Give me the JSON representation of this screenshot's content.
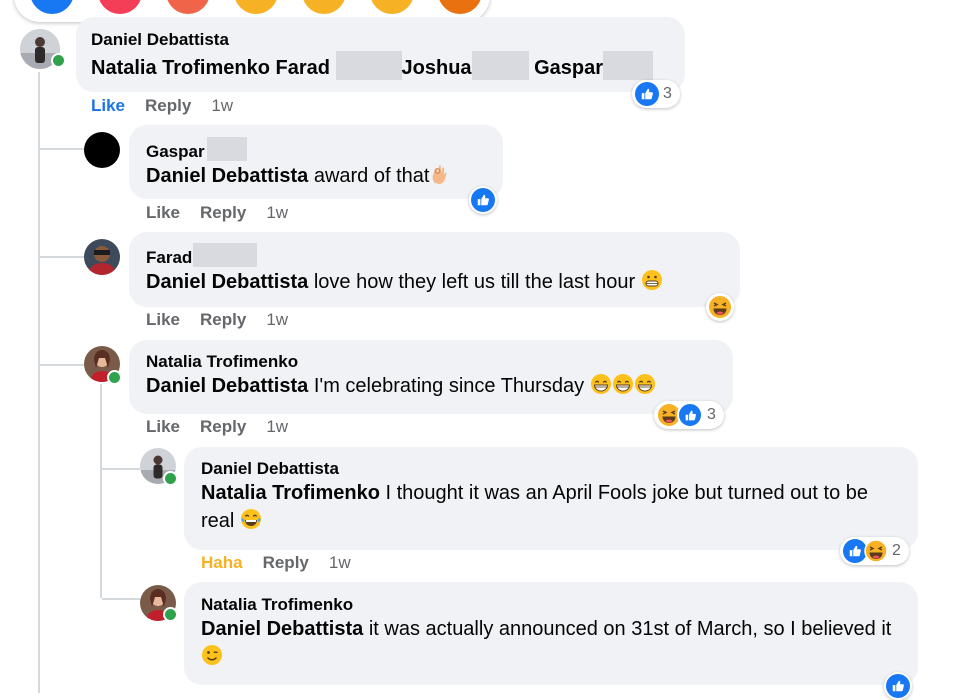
{
  "colors": {
    "like_blue": "#1877f2",
    "haha_yellow": "#f7b125",
    "bubble_bg": "#f0f2f5",
    "muted": "#65676b",
    "online": "#31a24c"
  },
  "top_reaction_bar": {
    "icons": [
      "like-icon",
      "love-icon",
      "care-icon",
      "haha-icon",
      "wow-icon",
      "sad-icon",
      "angry-icon"
    ]
  },
  "comments": [
    {
      "author": "Daniel Debattista",
      "mentions": [
        "Natalia Trofimenko",
        "Farad",
        "Joshua",
        "Gaspar"
      ],
      "like_label": "Like",
      "reply_label": "Reply",
      "time": "1w",
      "reactions": {
        "icons": [
          "like-icon"
        ],
        "count": "3"
      }
    },
    {
      "author": "Gaspar",
      "mention": "Daniel Debattista",
      "text": "award of that",
      "text_emoji": "ok-hand-icon",
      "like_label": "Like",
      "reply_label": "Reply",
      "time": "1w",
      "reactions": {
        "icons": [
          "like-icon"
        ]
      }
    },
    {
      "author": "Farad",
      "mention": "Daniel Debattista",
      "text": "love how they left us till the last hour",
      "text_emoji": "grimacing-face-icon",
      "like_label": "Like",
      "reply_label": "Reply",
      "time": "1w",
      "reactions": {
        "icons": [
          "haha-icon"
        ]
      }
    },
    {
      "author": "Natalia Trofimenko",
      "mention": "Daniel Debattista",
      "text": "I'm celebrating since Thursday",
      "text_emoji": "grinning-face-icon",
      "like_label": "Like",
      "reply_label": "Reply",
      "time": "1w",
      "reactions": {
        "icons": [
          "haha-icon",
          "like-icon"
        ],
        "count": "3"
      }
    },
    {
      "author": "Daniel Debattista",
      "mention": "Natalia Trofimenko",
      "text": "I thought it was an April Fools joke but turned out to be real",
      "text_emoji": "joy-face-icon",
      "like_label": "Haha",
      "reply_label": "Reply",
      "time": "1w",
      "reactions": {
        "icons": [
          "like-icon",
          "haha-icon"
        ],
        "count": "2"
      }
    },
    {
      "author": "Natalia Trofimenko",
      "mention": "Daniel Debattista",
      "text": "it was actually announced on 31st of March, so I believed it",
      "text_emoji": "wink-face-icon",
      "reactions": {
        "icons": [
          "like-icon"
        ]
      }
    }
  ]
}
